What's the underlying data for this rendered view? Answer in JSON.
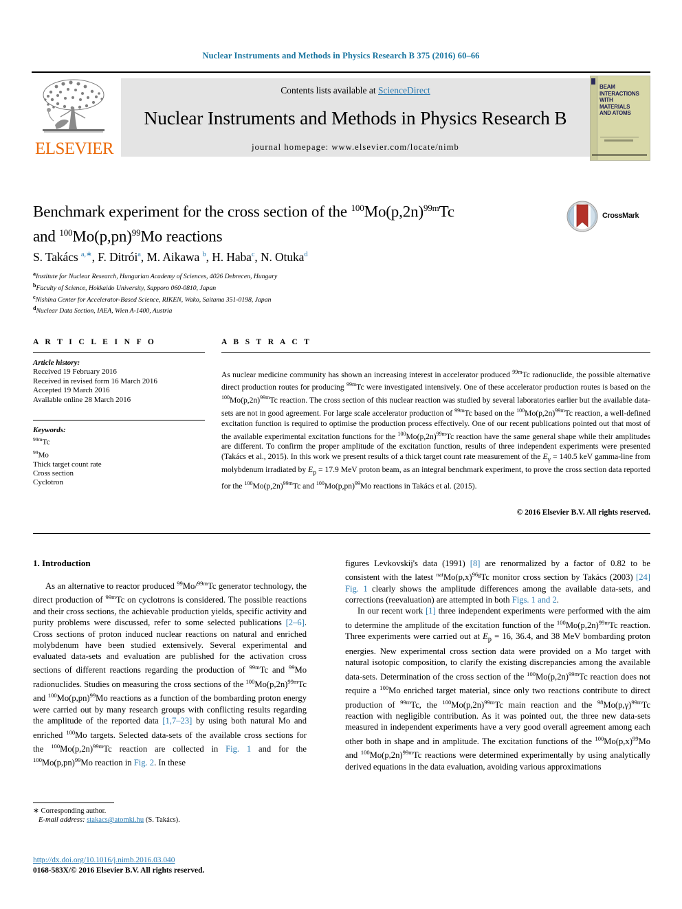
{
  "running_head": "Nuclear Instruments and Methods in Physics Research B 375 (2016) 60–66",
  "header": {
    "contents_prefix": "Contents lists available at ",
    "sciencedirect": "ScienceDirect",
    "journal_title": "Nuclear Instruments and Methods in Physics Research B",
    "homepage": "journal homepage: www.elsevier.com/locate/nimb",
    "publisher_logo_text": "ELSEVIER",
    "cover_title_lines": [
      "BEAM",
      "INTERACTIONS",
      "WITH",
      "MATERIALS",
      "AND ATOMS"
    ]
  },
  "article": {
    "title_line1_a": "Benchmark experiment for the cross section of the ",
    "title_sup1": "100",
    "title_line1_b": "Mo(p,2n)",
    "title_sup2": "99m",
    "title_line1_c": "Tc",
    "title_line2_a": "and ",
    "title_sup3": "100",
    "title_line2_b": "Mo(p,pn)",
    "title_sup4": "99",
    "title_line2_c": "Mo reactions",
    "crossmark_label": "CrossMark",
    "authors": [
      {
        "name": "S. Takács ",
        "sup": "a,∗",
        "sep": ", "
      },
      {
        "name": "F. Ditrói",
        "sup": "a",
        "sep": ", "
      },
      {
        "name": "M. Aikawa ",
        "sup": "b",
        "sep": ", "
      },
      {
        "name": "H. Haba",
        "sup": "c",
        "sep": ", "
      },
      {
        "name": "N. Otuka",
        "sup": "d",
        "sep": ""
      }
    ],
    "affiliations": [
      {
        "sup": "a",
        "text": "Institute for Nuclear Research, Hungarian Academy of Sciences, 4026 Debrecen, Hungary"
      },
      {
        "sup": "b",
        "text": "Faculty of Science, Hokkaido University, Sapporo 060-0810, Japan"
      },
      {
        "sup": "c",
        "text": "Nishina Center for Accelerator-Based Science, RIKEN, Wako, Saitama 351-0198, Japan"
      },
      {
        "sup": "d",
        "text": "Nuclear Data Section, IAEA, Wien A-1400, Austria"
      }
    ]
  },
  "article_info": {
    "heading": "A R T I C L E  I N F O",
    "history_label": "Article history:",
    "history": [
      "Received 19 February 2016",
      "Received in revised form 16 March 2016",
      "Accepted 19 March 2016",
      "Available online 28 March 2016"
    ],
    "keywords_label": "Keywords:",
    "keywords": [
      {
        "sup": "99m",
        "text": "Tc"
      },
      {
        "sup": "99",
        "text": "Mo"
      },
      {
        "sup": "",
        "text": "Thick target count rate"
      },
      {
        "sup": "",
        "text": "Cross section"
      },
      {
        "sup": "",
        "text": "Cyclotron"
      }
    ]
  },
  "abstract": {
    "heading": "A B S T R A C T",
    "copyright": "© 2016 Elsevier B.V. All rights reserved."
  },
  "body": {
    "intro_heading": "1. Introduction",
    "footnote_star": "∗ Corresponding author.",
    "footnote_email_label": "E-mail address:",
    "footnote_email": "stakacs@atomki.hu",
    "footnote_email_tail": " (S. Takács).",
    "doi": "http://dx.doi.org/10.1016/j.nimb.2016.03.040",
    "issn": "0168-583X/© 2016 Elsevier B.V. All rights reserved."
  },
  "colors": {
    "link": "#2a7ab0",
    "running_head": "#16739e",
    "elsevier_orange": "#eb6a0a"
  }
}
